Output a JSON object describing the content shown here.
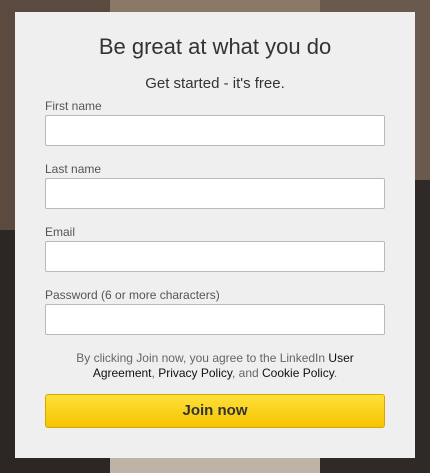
{
  "form": {
    "headline": "Be great at what you do",
    "subhead": "Get started - it's free.",
    "fields": [
      {
        "label": "First name",
        "value": ""
      },
      {
        "label": "Last name",
        "value": ""
      },
      {
        "label": "Email",
        "value": ""
      },
      {
        "label": "Password (6 or more characters)",
        "value": ""
      }
    ],
    "agreement": {
      "prefix": "By clicking Join now, you agree to the LinkedIn ",
      "user_agreement": "User Agreement",
      "sep1": ", ",
      "privacy_policy": "Privacy Policy",
      "sep2": ", and ",
      "cookie_policy": "Cookie Policy",
      "suffix": "."
    },
    "join_label": "Join now"
  },
  "colors": {
    "card_background": "#efefef",
    "join_button": "#f5c400",
    "backdrop": "#3a3230"
  }
}
